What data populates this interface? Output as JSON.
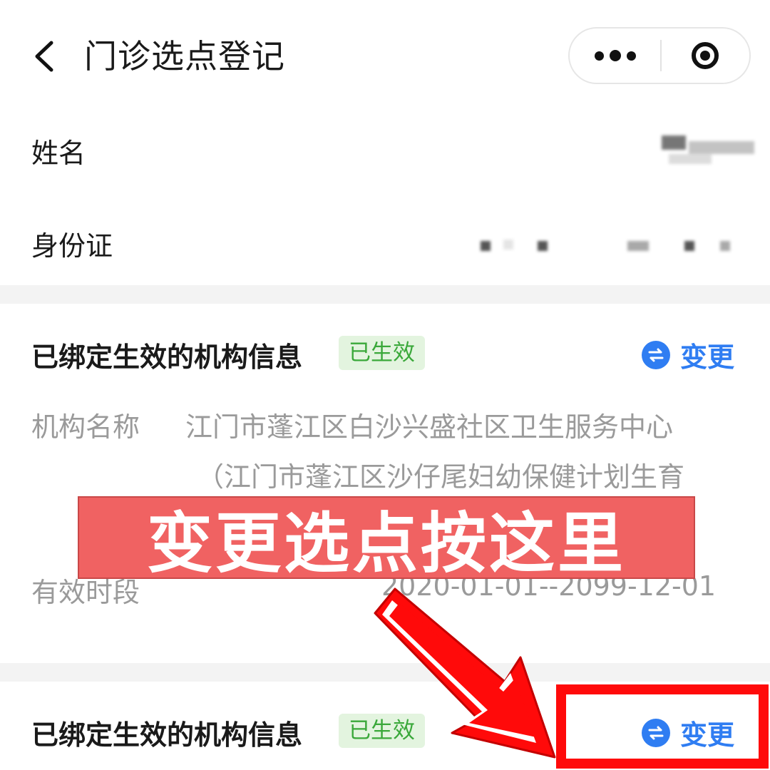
{
  "header": {
    "title": "门诊选点登记",
    "back_icon": "chevron-left-icon",
    "more_icon": "more-dots-icon",
    "close_icon": "target-circle-icon"
  },
  "profile": {
    "name_label": "姓名",
    "id_label": "身份证"
  },
  "cards": [
    {
      "title": "已绑定生效的机构信息",
      "badge": "已生效",
      "change_label": "变更",
      "institution_label": "机构名称",
      "institution_line1": "江门市蓬江区白沙兴盛社区卫生服务中心",
      "institution_line2": "（江门市蓬江区沙仔尾妇幼保健计划生育",
      "period_label": "有效时段",
      "period_value": "2020-01-01--2099-12-01"
    },
    {
      "title": "已绑定生效的机构信息",
      "badge": "已生效",
      "change_label": "变更"
    }
  ],
  "overlay": {
    "banner_text": "变更选点按这里"
  },
  "colors": {
    "accent_blue": "#2f7df2",
    "badge_green": "#3aa83a",
    "banner_red": "#f06262",
    "highlight_red": "#ff0a0a"
  }
}
